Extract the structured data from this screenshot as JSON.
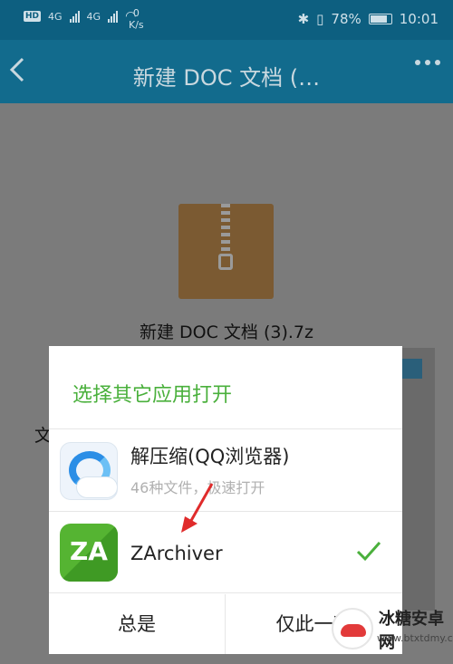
{
  "status_bar": {
    "hd": "HD",
    "network_a": "4G",
    "network_b": "4G",
    "speed_value": "0",
    "speed_unit": "K/s",
    "battery": "78%",
    "time": "10:01"
  },
  "app_bar": {
    "back_icon": "chevron-left-icon",
    "title": "新建 DOC 文档 (…",
    "more_icon": "more-horizontal-icon"
  },
  "file": {
    "icon": "zip-archive-icon",
    "name": "新建 DOC 文档 (3).7z",
    "background_text": "文"
  },
  "dialog": {
    "title": "选择其它应用打开",
    "apps": [
      {
        "name": "解压缩(QQ浏览器)",
        "subtitle": "46种文件，极速打开",
        "icon": "qq-browser-icon"
      },
      {
        "name": "ZArchiver",
        "icon": "zarchiver-icon",
        "icon_text": "ZA",
        "selected": true
      }
    ],
    "buttons": {
      "always": "总是",
      "once": "仅此一次"
    }
  },
  "watermark": {
    "name": "冰糖安卓网",
    "url": "www.btxtdmy.com"
  },
  "colors": {
    "status_bar_bg": "#0d5f80",
    "app_bar_bg": "#126b8d",
    "accent_green": "#4ab03c",
    "annotation_red": "#e02b2b"
  }
}
